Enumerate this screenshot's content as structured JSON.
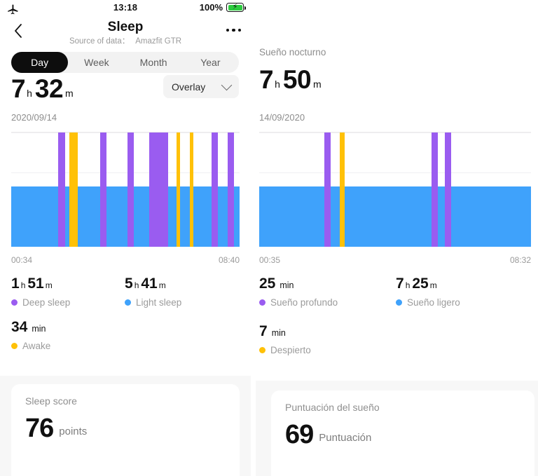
{
  "status_bar": {
    "airplane_icon": "airplane-icon",
    "time": "13:18",
    "battery_percent": "100%",
    "battery_icon": "battery-charging-icon"
  },
  "left_panel": {
    "nav": {
      "back_icon": "chevron-left-icon",
      "title": "Sleep",
      "source_label": "Source of data：",
      "source_value": "Amazfit GTR",
      "more_icon": "more-horizontal-icon"
    },
    "tabs": [
      {
        "label": "Day",
        "active": true
      },
      {
        "label": "Week",
        "active": false
      },
      {
        "label": "Month",
        "active": false
      },
      {
        "label": "Year",
        "active": false
      }
    ],
    "duration": {
      "hours": "7",
      "hours_unit": "h",
      "minutes": "32",
      "minutes_unit": "m"
    },
    "overlay_select": {
      "label": "Overlay",
      "chevron_icon": "chevron-down-icon"
    },
    "date": "2020/09/14",
    "chart_axis": {
      "start": "00:34",
      "end": "08:40"
    },
    "stats": [
      {
        "value": "1",
        "unit": "h",
        "value2": "51",
        "unit2": "m",
        "legend": "Deep sleep",
        "color": "#9a5cf0"
      },
      {
        "value": "5",
        "unit": "h",
        "value2": "41",
        "unit2": "m",
        "legend": "Light sleep",
        "color": "#3fa2fb"
      },
      {
        "value": "34",
        "unit": "",
        "value2": "",
        "unit2": "min",
        "legend": "Awake",
        "color": "#ffc107"
      }
    ],
    "score_card": {
      "title": "Sleep score",
      "value": "76",
      "unit": "points"
    }
  },
  "right_panel": {
    "section_title": "Sueño nocturno",
    "duration": {
      "hours": "7",
      "hours_unit": "h",
      "minutes": "50",
      "minutes_unit": "m"
    },
    "date": "14/09/2020",
    "chart_axis": {
      "start": "00:35",
      "end": "08:32"
    },
    "stats": [
      {
        "value": "25",
        "unit": "",
        "value2": "",
        "unit2": "min",
        "legend": "Sueño profundo",
        "color": "#9a5cf0"
      },
      {
        "value": "7",
        "unit": "h",
        "value2": "25",
        "unit2": "m",
        "legend": "Sueño ligero",
        "color": "#3fa2fb"
      },
      {
        "value": "7",
        "unit": "",
        "value2": "",
        "unit2": "min",
        "legend": "Despierto",
        "color": "#ffc107"
      }
    ],
    "score_card": {
      "title": "Puntuación del sueño",
      "value": "69",
      "unit": "Puntuación"
    }
  },
  "colors": {
    "deep_sleep": "#9a5cf0",
    "light_sleep": "#3fa2fb",
    "awake": "#ffc107",
    "accent_black": "#0d0d0d",
    "muted_text": "#9a9a9a",
    "card_bg": "#f7f7f7"
  },
  "chart_data": [
    {
      "type": "bar",
      "id": "left-sleep-timeline",
      "title": "Sleep stages 2020/09/14",
      "xlabel": "",
      "ylabel": "",
      "x_start": "00:34",
      "x_end": "08:40",
      "grid": true,
      "legend": [
        "Deep sleep",
        "Light sleep",
        "Awake"
      ],
      "segments": [
        {
          "stage": "light",
          "x_pct": 0.0,
          "w_pct": 100.0,
          "h_pct": 53.0
        },
        {
          "stage": "deep",
          "x_pct": 20.5,
          "w_pct": 3.2,
          "h_pct": 100.0
        },
        {
          "stage": "awake",
          "x_pct": 25.4,
          "w_pct": 3.7,
          "h_pct": 100.0
        },
        {
          "stage": "deep",
          "x_pct": 39.0,
          "w_pct": 2.8,
          "h_pct": 100.0
        },
        {
          "stage": "deep",
          "x_pct": 50.9,
          "w_pct": 2.8,
          "h_pct": 100.0
        },
        {
          "stage": "deep",
          "x_pct": 60.4,
          "w_pct": 8.3,
          "h_pct": 100.0
        },
        {
          "stage": "awake",
          "x_pct": 72.4,
          "w_pct": 1.5,
          "h_pct": 100.0
        },
        {
          "stage": "awake",
          "x_pct": 78.2,
          "w_pct": 1.5,
          "h_pct": 100.0
        },
        {
          "stage": "deep",
          "x_pct": 87.7,
          "w_pct": 2.8,
          "h_pct": 100.0
        },
        {
          "stage": "deep",
          "x_pct": 94.8,
          "w_pct": 2.8,
          "h_pct": 100.0
        }
      ],
      "totals": {
        "deep": "1h51m",
        "light": "5h41m",
        "awake": "34min",
        "total": "7h32m"
      }
    },
    {
      "type": "bar",
      "id": "right-sleep-timeline",
      "title": "Sueño nocturno 14/09/2020",
      "xlabel": "",
      "ylabel": "",
      "x_start": "00:35",
      "x_end": "08:32",
      "grid": true,
      "legend": [
        "Sueño profundo",
        "Sueño ligero",
        "Despierto"
      ],
      "segments": [
        {
          "stage": "light",
          "x_pct": 0.0,
          "w_pct": 100.0,
          "h_pct": 53.0
        },
        {
          "stage": "deep",
          "x_pct": 24.0,
          "w_pct": 2.3,
          "h_pct": 100.0
        },
        {
          "stage": "awake",
          "x_pct": 29.6,
          "w_pct": 1.9,
          "h_pct": 100.0
        },
        {
          "stage": "deep",
          "x_pct": 63.5,
          "w_pct": 2.3,
          "h_pct": 100.0
        },
        {
          "stage": "deep",
          "x_pct": 68.3,
          "w_pct": 2.3,
          "h_pct": 100.0
        }
      ],
      "totals": {
        "deep": "25min",
        "light": "7h25m",
        "awake": "7min",
        "total": "7h50m"
      }
    }
  ]
}
